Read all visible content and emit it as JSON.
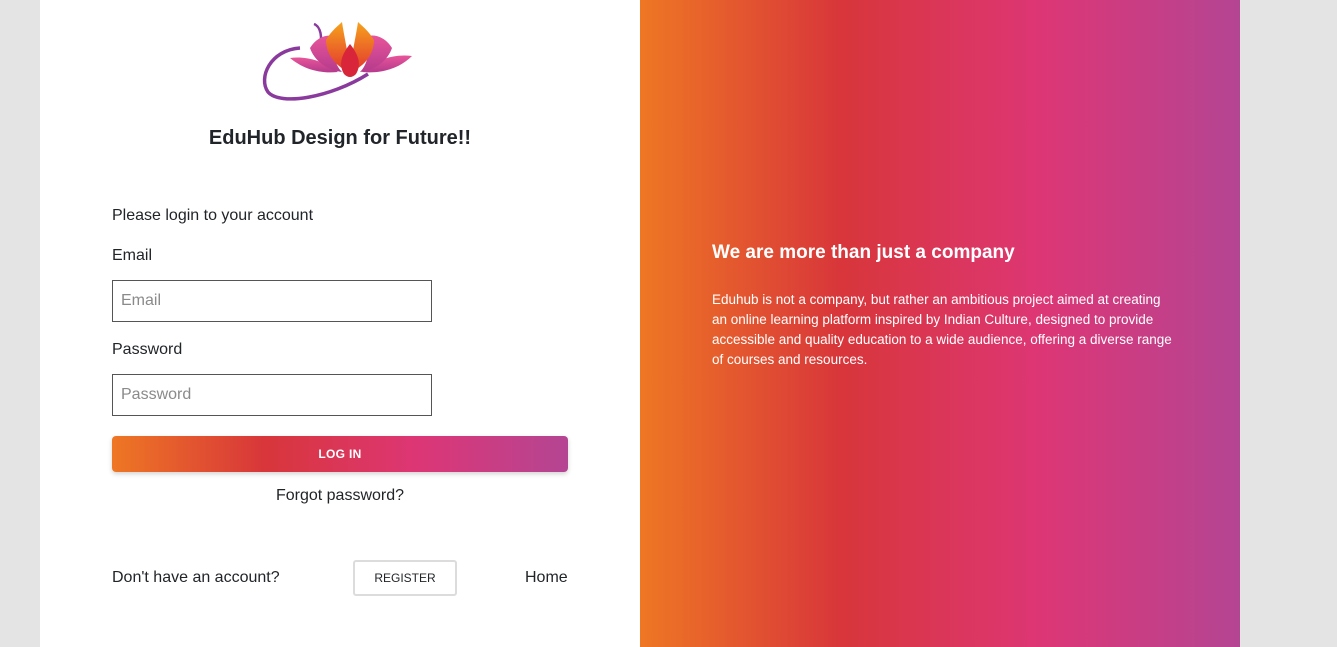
{
  "brand": {
    "title": "EduHub Design for Future!!",
    "logo_icon": "lotus-logo-icon"
  },
  "login": {
    "subtitle": "Please login to your account",
    "email_label": "Email",
    "email_placeholder": "Email",
    "email_value": "",
    "password_label": "Password",
    "password_placeholder": "Password",
    "password_value": "",
    "login_button": "LOG IN",
    "forgot_link": "Forgot password?",
    "no_account_text": "Don't have an account?",
    "register_button": "REGISTER",
    "home_link": "Home"
  },
  "panel": {
    "heading": "We are more than just a company",
    "text": "Eduhub is not a company, but rather an ambitious project aimed at creating an online learning platform inspired by Indian Culture, designed to provide accessible and quality education to a wide audience, offering a diverse range of courses and resources."
  },
  "colors": {
    "gradient": [
      "#ee7724",
      "#d8363a",
      "#dd3675",
      "#b44593"
    ],
    "page_background": "#e4e4e4"
  }
}
